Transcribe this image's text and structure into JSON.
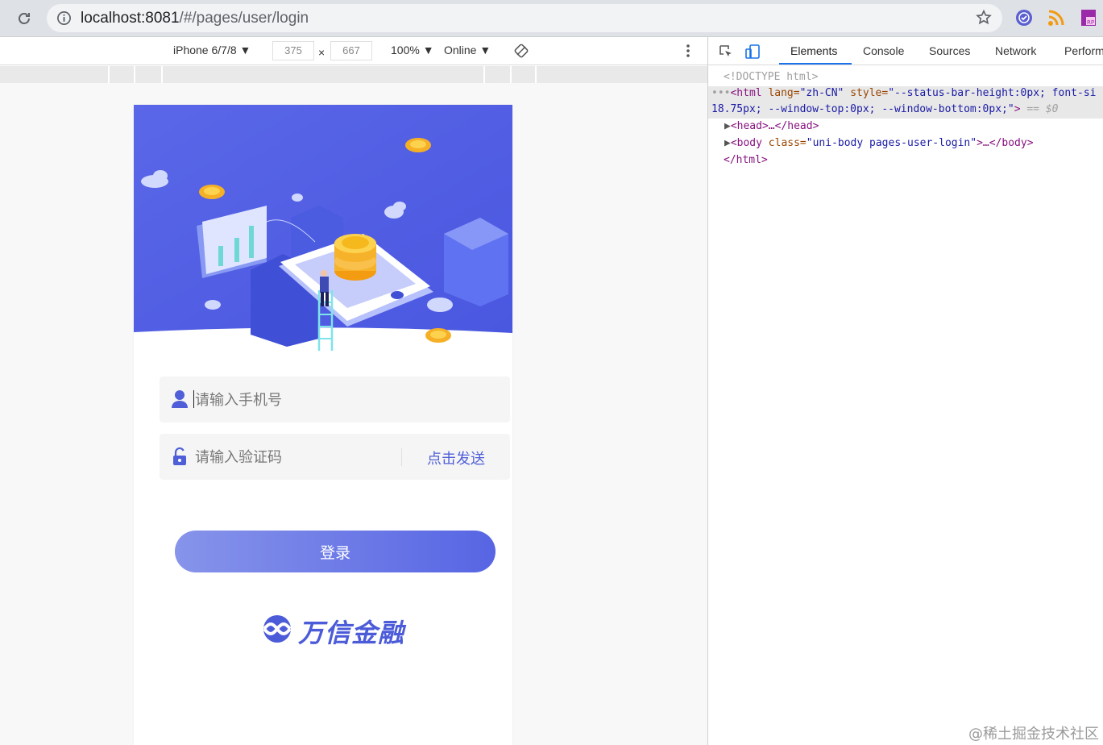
{
  "browser": {
    "url_host": "localhost:8081",
    "url_path": "/#/pages/user/login"
  },
  "device_toolbar": {
    "device": "iPhone 6/7/8 ▼",
    "width": "375",
    "times": "×",
    "height": "667",
    "zoom": "100% ▼",
    "network": "Online ▼"
  },
  "login": {
    "phone_placeholder": "请输入手机号",
    "code_placeholder": "请输入验证码",
    "send_code": "点击发送",
    "login_button": "登录",
    "brand_name": "万信金融"
  },
  "devtools": {
    "tabs": [
      "Elements",
      "Console",
      "Sources",
      "Network",
      "Perform"
    ],
    "active_tab": "Elements",
    "doctype": "<!DOCTYPE html>",
    "html_open_prefix": "<html",
    "html_lang_attr": " lang=",
    "html_lang_val": "\"zh-CN\"",
    "html_style_attr": " style=",
    "html_style_val_1": "\"--status-bar-height:0px; font-si",
    "html_style_val_2": "18.75px; --window-top:0px; --window-bottom:0px;\"",
    "html_eq": " == $0",
    "head_line": "<head>…</head>",
    "body_tag_open": "<body",
    "body_class_attr": " class=",
    "body_class_val": "\"uni-body pages-user-login\"",
    "body_rest": ">…</body>",
    "html_close": "</html>"
  },
  "watermark": "@稀土掘金技术社区",
  "colors": {
    "accent": "#4f5fd8",
    "hero_bg": "#5563e6",
    "button_from": "#8794ea",
    "button_to": "#5765e4"
  }
}
